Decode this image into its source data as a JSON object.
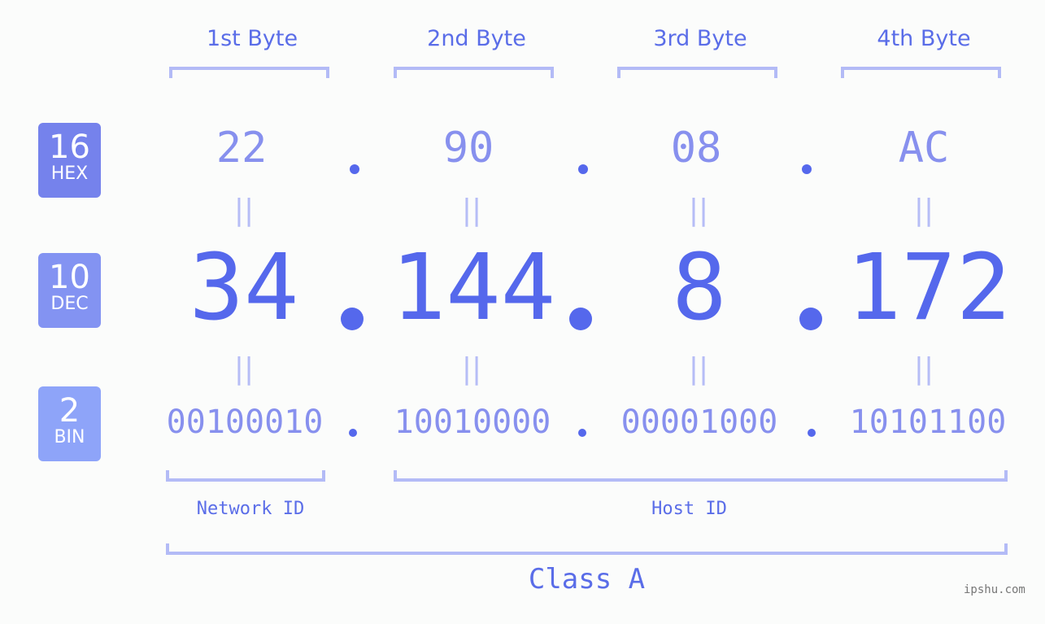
{
  "byte_headers": [
    "1st Byte",
    "2nd Byte",
    "3rd Byte",
    "4th Byte"
  ],
  "rows": {
    "hex": {
      "base": "16",
      "label": "HEX",
      "color": "#7582ec",
      "values": [
        "22",
        "90",
        "08",
        "AC"
      ]
    },
    "dec": {
      "base": "10",
      "label": "DEC",
      "color": "#8393f2",
      "values": [
        "34",
        "144",
        "8",
        "172"
      ]
    },
    "bin": {
      "base": "2",
      "label": "BIN",
      "color": "#8ea4f9",
      "values": [
        "00100010",
        "10010000",
        "00001000",
        "10101100"
      ]
    }
  },
  "separator": ".",
  "equals_symbol": "||",
  "segments": {
    "network": "Network ID",
    "host": "Host ID"
  },
  "class_label": "Class A",
  "watermark": "ipshu.com",
  "colors": {
    "primary": "#5568ec",
    "light": "#8790ee",
    "bracket": "#b3bbf6",
    "background": "#fbfcfb"
  }
}
